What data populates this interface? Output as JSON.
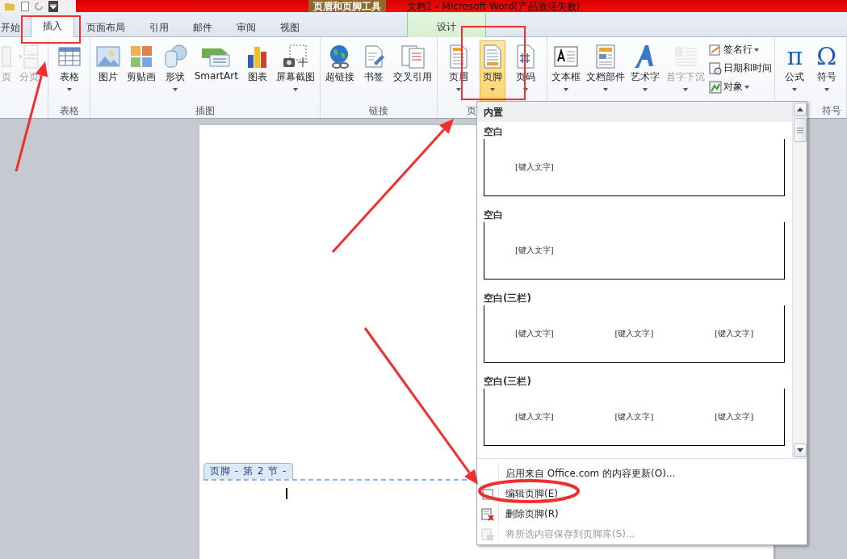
{
  "title_bar": {
    "context_tab": "页眉和页脚工具",
    "title": "文档1 - Microsoft Word(产品激活失败)"
  },
  "tabs": [
    {
      "label": "开始",
      "selected": false,
      "contextual": false
    },
    {
      "label": "插入",
      "selected": true,
      "contextual": false
    },
    {
      "label": "页面布局",
      "selected": false,
      "contextual": false
    },
    {
      "label": "引用",
      "selected": false,
      "contextual": false
    },
    {
      "label": "邮件",
      "selected": false,
      "contextual": false
    },
    {
      "label": "审阅",
      "selected": false,
      "contextual": false
    },
    {
      "label": "视图",
      "selected": false,
      "contextual": false
    },
    {
      "label": "设计",
      "selected": false,
      "contextual": true
    }
  ],
  "ribbon": {
    "groups": [
      {
        "items": [
          {
            "label": "页",
            "disabled": true,
            "dropdown": false,
            "pressed": false
          },
          {
            "label": "分页",
            "disabled": true,
            "dropdown": false,
            "pressed": false
          }
        ]
      },
      {
        "label": "表格",
        "items": [
          {
            "label": "表格",
            "disabled": false,
            "dropdown": true,
            "pressed": false
          }
        ]
      },
      {
        "label": "插图",
        "items": [
          {
            "label": "图片",
            "disabled": false,
            "dropdown": false,
            "pressed": false
          },
          {
            "label": "剪贴画",
            "disabled": false,
            "dropdown": false,
            "pressed": false
          },
          {
            "label": "形状",
            "disabled": false,
            "dropdown": true,
            "pressed": false
          },
          {
            "label": "SmartArt",
            "disabled": false,
            "dropdown": false,
            "pressed": false
          },
          {
            "label": "图表",
            "disabled": false,
            "dropdown": false,
            "pressed": false
          },
          {
            "label": "屏幕截图",
            "disabled": false,
            "dropdown": true,
            "pressed": false
          }
        ]
      },
      {
        "label": "链接",
        "items": [
          {
            "label": "超链接",
            "disabled": false,
            "dropdown": false,
            "pressed": false
          },
          {
            "label": "书签",
            "disabled": false,
            "dropdown": false,
            "pressed": false
          },
          {
            "label": "交叉引用",
            "disabled": false,
            "dropdown": false,
            "pressed": false
          }
        ]
      },
      {
        "label": "页",
        "items": [
          {
            "label": "页眉",
            "disabled": false,
            "dropdown": true,
            "pressed": false
          },
          {
            "label": "页脚",
            "disabled": false,
            "dropdown": true,
            "pressed": true
          },
          {
            "label": "页码",
            "disabled": false,
            "dropdown": true,
            "pressed": false
          }
        ]
      },
      {
        "items": [
          {
            "label": "文本框",
            "disabled": false,
            "dropdown": true,
            "pressed": false
          },
          {
            "label": "文档部件",
            "disabled": false,
            "dropdown": true,
            "pressed": false
          },
          {
            "label": "艺术字",
            "disabled": false,
            "dropdown": true,
            "pressed": false
          },
          {
            "label": "首字下沉",
            "disabled": true,
            "dropdown": true,
            "pressed": false
          }
        ],
        "small_items": [
          {
            "label": "签名行",
            "dropdown": true
          },
          {
            "label": "日期和时间",
            "dropdown": false
          },
          {
            "label": "对象",
            "dropdown": true
          }
        ]
      },
      {
        "label": "符号",
        "items": [
          {
            "label": "公式",
            "glyph": "π",
            "disabled": false,
            "dropdown": true,
            "pressed": false
          },
          {
            "label": "符号",
            "glyph": "Ω",
            "disabled": false,
            "dropdown": true,
            "pressed": false
          }
        ]
      }
    ]
  },
  "document": {
    "footer_tab": "页脚 - 第 2 节 -"
  },
  "footer_menu": {
    "section": "内置",
    "gallery": [
      {
        "title": "空白",
        "columns": [
          "[键入文字]"
        ]
      },
      {
        "title": "空白",
        "columns": [
          "[键入文字]"
        ]
      },
      {
        "title": "空白(三栏)",
        "columns": [
          "[键入文字]",
          "[键入文字]",
          "[键入文字]"
        ]
      },
      {
        "title": "空白(三栏)",
        "columns": [
          "[键入文字]",
          "[键入文字]",
          "[键入文字]"
        ]
      }
    ],
    "items": [
      {
        "label": "启用来自 Office.com 的内容更新(O)...",
        "disabled": false
      },
      {
        "label": "编辑页脚(E)",
        "disabled": false
      },
      {
        "label": "删除页脚(R)",
        "disabled": false
      },
      {
        "label": "将所选内容保存到页脚库(S)...",
        "disabled": true
      }
    ]
  }
}
